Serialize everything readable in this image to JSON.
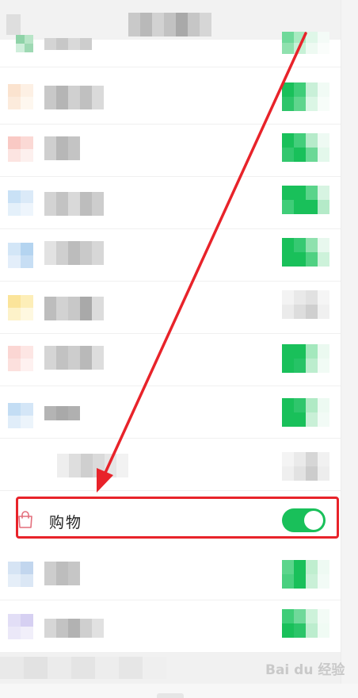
{
  "highlighted_row": {
    "label": "购物",
    "toggle_on": true
  },
  "watermark": "Bai du 经验",
  "colors": {
    "accent_green": "#19c05a",
    "highlight_red": "#e8232a"
  },
  "icons": {
    "row_icon": "shopping-bag-icon"
  }
}
